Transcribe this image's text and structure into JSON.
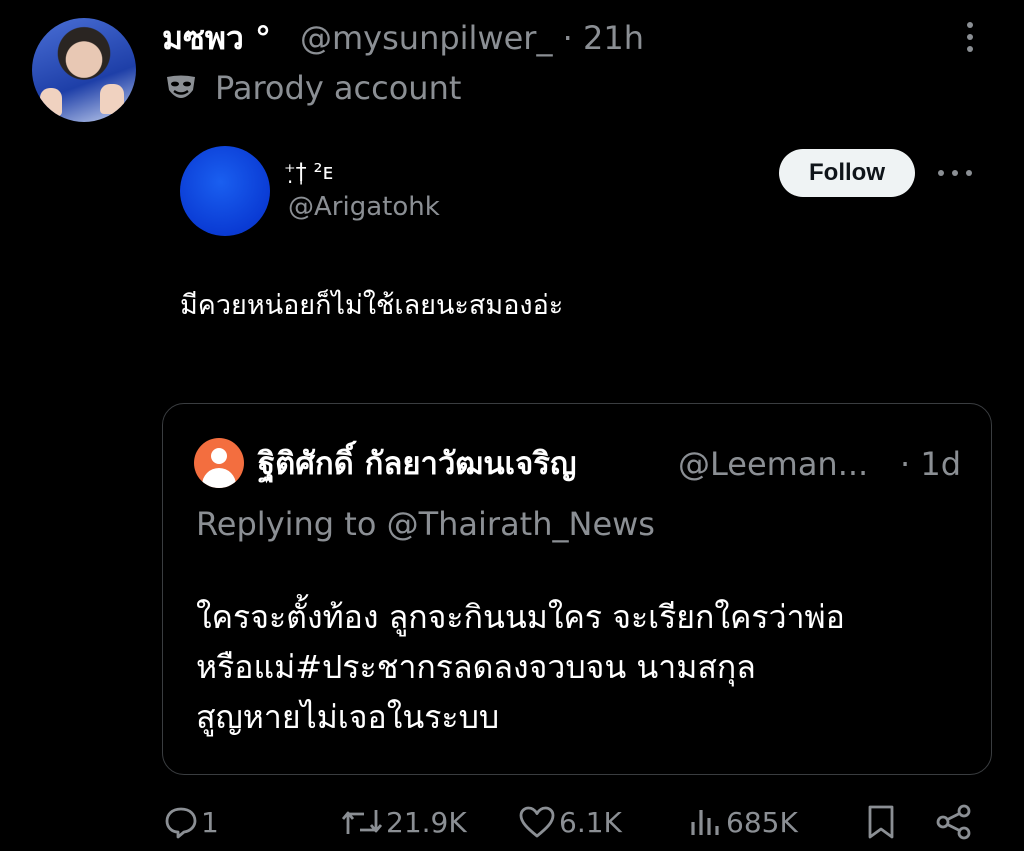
{
  "tweet": {
    "display_name": "มซพว °",
    "handle_time": "@mysunpilwer_ · 21h",
    "label": "Parody account"
  },
  "embedded": {
    "name": "⁺̣†̩ ²ᴇ",
    "handle": "@Arigatohk",
    "follow_label": "Follow",
    "text": "มีควยหน่อยก็ไม่ใช้เลยนะสมองอ่ะ"
  },
  "quote": {
    "name": "ฐิติศักดิ์ กัลยาวัฒนเจริญ",
    "handle": "@Leeman...",
    "time": "· 1d",
    "replying": "Replying to @Thairath_News",
    "lines": [
      "ใครจะตั้งท้อง ลูกจะกินนมใคร จะเรียกใครว่าพ่อ",
      "หรือแม่#ประชากรลดลงจวบจน นามสกุล",
      "สูญหายไม่เจอในระบบ"
    ]
  },
  "actions": {
    "replies": "1",
    "reposts": "21.9K",
    "likes": "6.1K",
    "views": "685K"
  },
  "icons": [
    "more-vertical-icon",
    "theater-mask-icon",
    "more-horizontal-icon",
    "reply-icon",
    "repost-icon",
    "like-icon",
    "views-icon",
    "bookmark-icon",
    "share-icon"
  ]
}
